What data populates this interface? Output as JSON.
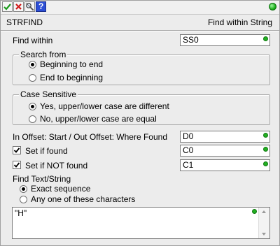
{
  "toolbar": {
    "buttons": [
      {
        "icon": "check-icon"
      },
      {
        "icon": "close-icon"
      },
      {
        "icon": "zoom-icon"
      },
      {
        "icon": "help-icon",
        "label": "?"
      }
    ],
    "status_color": "#22b022"
  },
  "header": {
    "instruction": "STRFIND",
    "description": "Find within String"
  },
  "find_within": {
    "label": "Find within",
    "value": "SS0"
  },
  "search_from": {
    "legend": "Search from",
    "options": [
      {
        "label": "Beginning to end",
        "selected": true
      },
      {
        "label": "End to beginning",
        "selected": false
      }
    ]
  },
  "case_sensitive": {
    "legend": "Case Sensitive",
    "options": [
      {
        "label": "Yes, upper/lower case are different",
        "selected": true
      },
      {
        "label": "No, upper/lower case are equal",
        "selected": false
      }
    ]
  },
  "offset": {
    "label": "In Offset: Start / Out Offset: Where Found",
    "value": "D0"
  },
  "set_if_found": {
    "label": "Set if found",
    "checked": true,
    "value": "C0"
  },
  "set_if_not_found": {
    "label": "Set if NOT found",
    "checked": true,
    "value": "C1"
  },
  "find_text": {
    "label": "Find Text/String",
    "options": [
      {
        "label": "Exact sequence",
        "selected": true
      },
      {
        "label": "Any one of these characters",
        "selected": false
      }
    ],
    "value": "\"H\""
  }
}
